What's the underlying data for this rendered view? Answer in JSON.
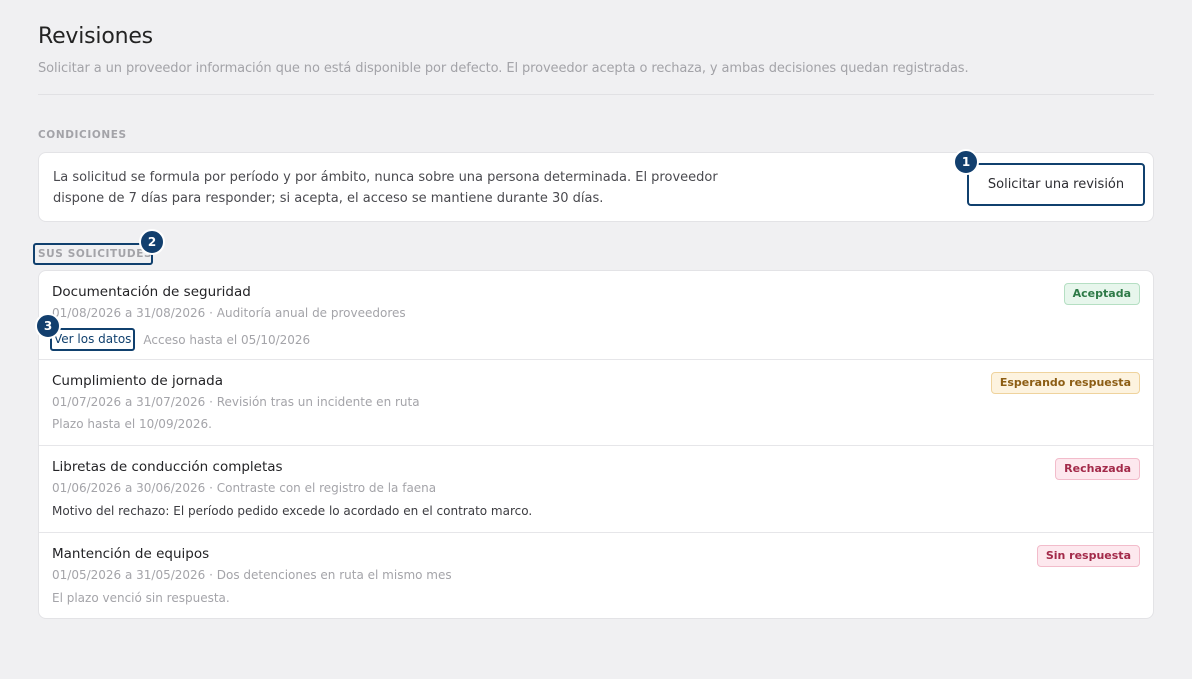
{
  "header": {
    "title": "Revisiones",
    "subtitle": "Solicitar a un proveedor información que no está disponible por defecto. El proveedor acepta o rechaza, y ambas decisiones quedan registradas."
  },
  "conditions": {
    "label": "CONDICIONES",
    "line1": "La solicitud se formula por período y por ámbito, nunca sobre una persona determinada. El proveedor",
    "line2": "dispone de 7 días para responder; si acepta, el acceso se mantiene durante 30 días.",
    "button_label": "Solicitar una revisión"
  },
  "requests": {
    "label": "SUS SOLICITUDES",
    "items": [
      {
        "title": "Documentación de seguridad",
        "meta": "01/08/2026 a 31/08/2026 · Auditoría anual de proveedores",
        "badge": "Aceptada",
        "link": "Ver los datos",
        "note": "Acceso hasta el 05/10/2026"
      },
      {
        "title": "Cumplimiento de jornada",
        "meta": "01/07/2026 a 31/07/2026 · Revisión tras un incidente en ruta",
        "badge": "Esperando respuesta",
        "note": "Plazo hasta el 10/09/2026."
      },
      {
        "title": "Libretas de conducción completas",
        "meta": "01/06/2026 a 30/06/2026 · Contraste con el registro de la faena",
        "badge": "Rechazada",
        "note": "Motivo del rechazo: El período pedido excede lo acordado en el contrato marco."
      },
      {
        "title": "Mantención de equipos",
        "meta": "01/05/2026 a 31/05/2026 · Dos detenciones en ruta el mismo mes",
        "badge": "Sin respuesta",
        "note": "El plazo venció sin respuesta."
      }
    ]
  },
  "markers": [
    "1",
    "2",
    "3"
  ],
  "colors": {
    "accent": "#10406e",
    "accepted": "#2e7a47",
    "waiting": "#8c5d14",
    "rejected": "#a32a4a"
  }
}
